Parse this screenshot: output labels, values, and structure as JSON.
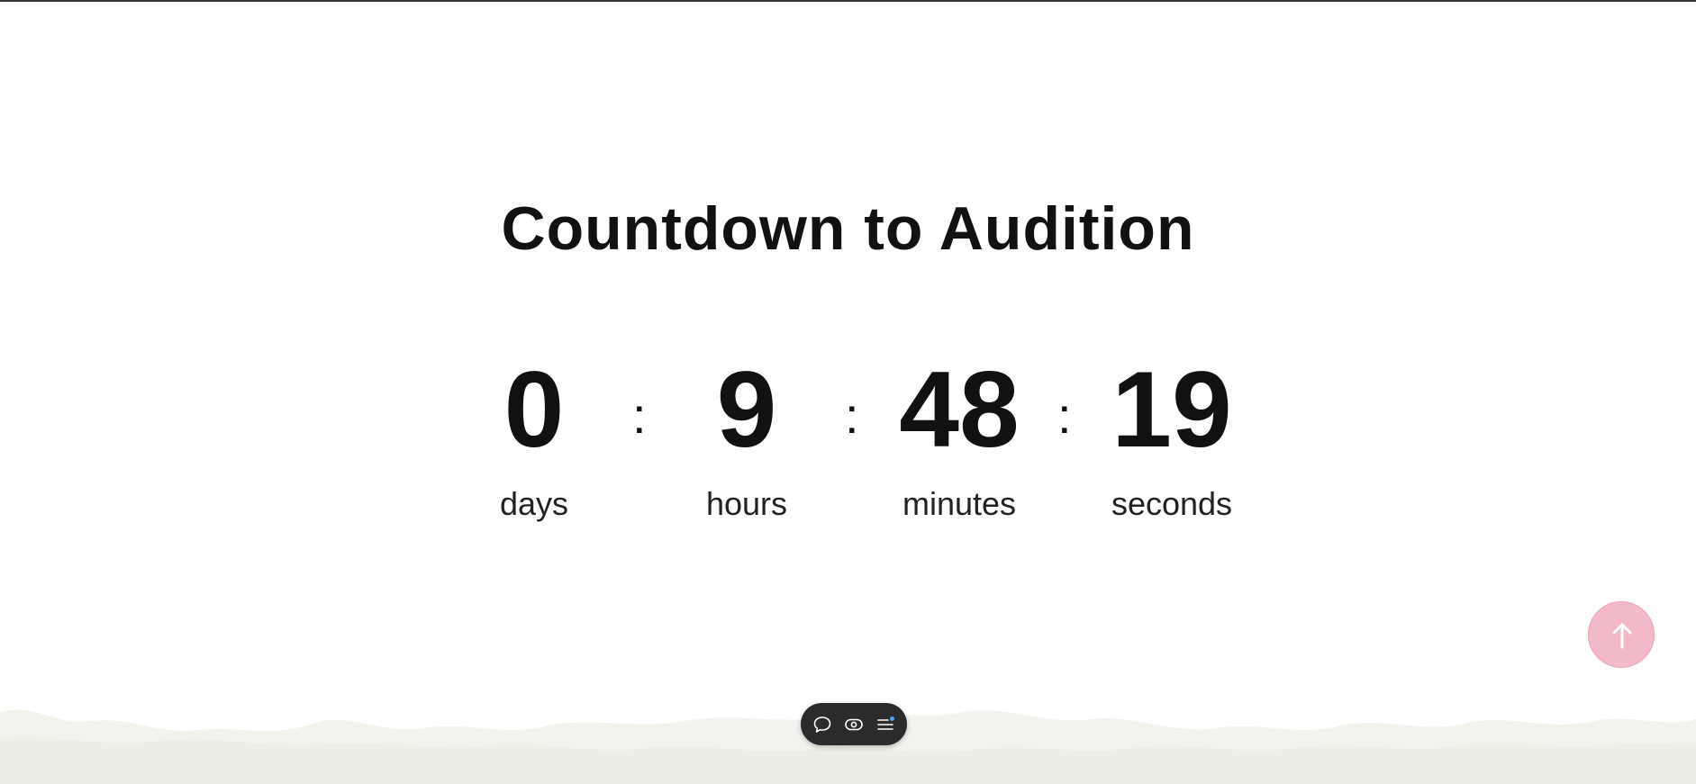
{
  "page": {
    "title": "Countdown to Audition"
  },
  "countdown": {
    "days": {
      "value": "0",
      "label": "days"
    },
    "hours": {
      "value": "9",
      "label": "hours"
    },
    "minutes": {
      "value": "48",
      "label": "minutes"
    },
    "seconds": {
      "value": "19",
      "label": "seconds"
    },
    "separator": ":"
  },
  "scroll_to_top": {
    "icon": "arrow-up-icon",
    "color": "#f4b9c8"
  },
  "floating_toolbar": {
    "items": [
      {
        "icon": "chat-bubble-icon"
      },
      {
        "icon": "eye-toggle-icon"
      },
      {
        "icon": "menu-list-icon",
        "badge_color": "#4ea1ff"
      }
    ],
    "background": "#2b2b2b"
  }
}
